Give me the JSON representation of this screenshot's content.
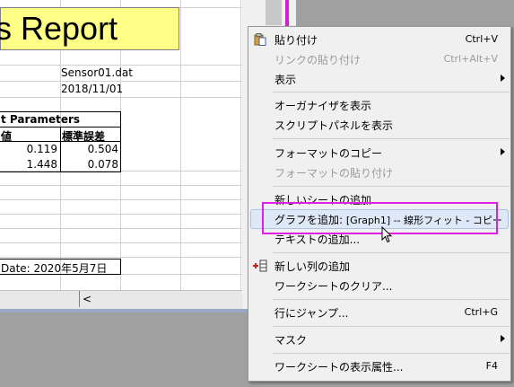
{
  "sheet": {
    "title": "s Report",
    "file": "Sensor01.dat",
    "date": "2018/11/01",
    "table_title": "t Parameters",
    "headers": [
      "値",
      "標準誤差"
    ],
    "rows": [
      [
        "0.119",
        "0.504"
      ],
      [
        "1.448",
        "0.078"
      ]
    ],
    "footer_date": "Date: 2020年5月7日",
    "scroll_left": "<"
  },
  "menu": {
    "paste": {
      "label": "貼り付け",
      "shortcut": "Ctrl+V"
    },
    "paste_link": {
      "label": "リンクの貼り付け",
      "shortcut": "Ctrl+Alt+V"
    },
    "view": {
      "label": "表示"
    },
    "show_organizer": {
      "label": "オーガナイザを表示"
    },
    "show_script": {
      "label": "スクリプトパネルを表示"
    },
    "copy_format": {
      "label": "フォーマットのコピー"
    },
    "paste_format": {
      "label": "フォーマットの貼り付け"
    },
    "add_sheet": {
      "label": "新しいシートの追加"
    },
    "add_graph": {
      "label": "グラフを追加:",
      "detail": "[Graph1] -- 線形フィット - コピー"
    },
    "add_text": {
      "label": "テキストの追加..."
    },
    "add_column": {
      "label": "新しい列の追加"
    },
    "clear_sheet": {
      "label": "ワークシートのクリア..."
    },
    "jump_row": {
      "label": "行にジャンプ...",
      "shortcut": "Ctrl+G"
    },
    "mask": {
      "label": "マスク"
    },
    "sheet_props": {
      "label": "ワークシートの表示属性...",
      "shortcut": "F4"
    }
  },
  "colors": {
    "title_bg": "#ffff88",
    "highlight_border": "#e020e0",
    "menu_bg": "#f0f0f0"
  }
}
